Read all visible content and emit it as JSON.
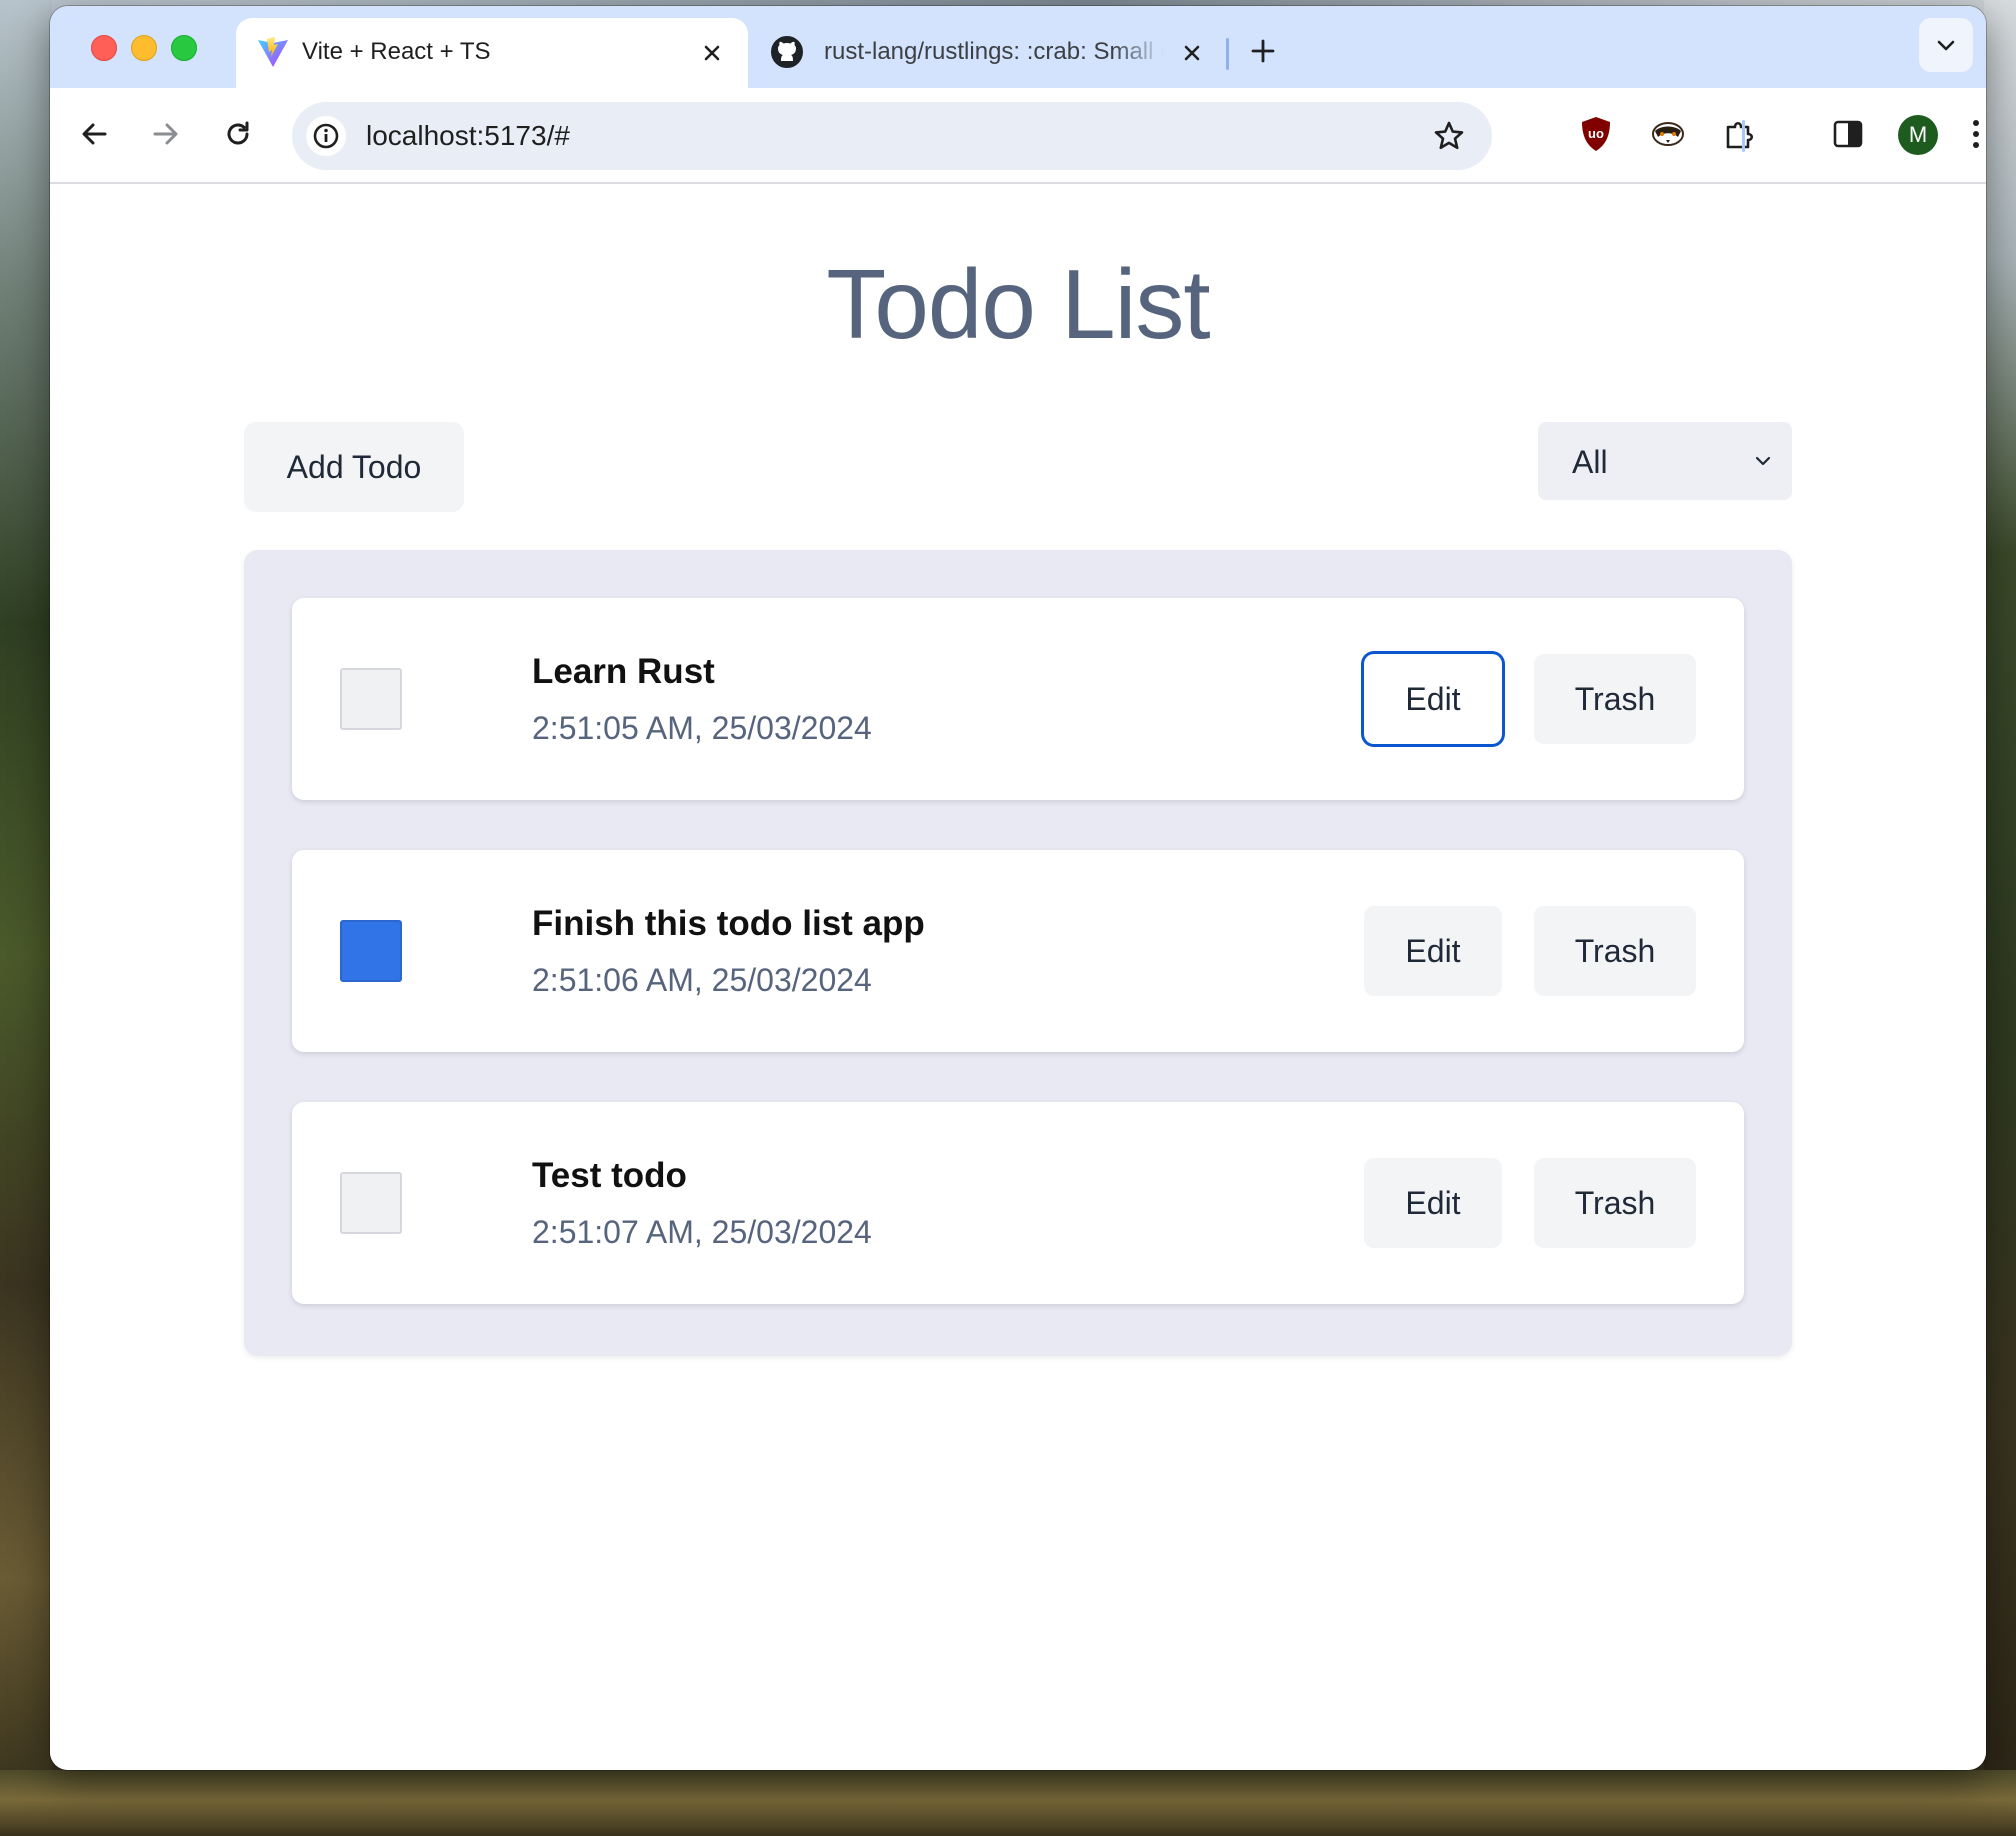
{
  "browser": {
    "tabs": [
      {
        "title": "Vite + React + TS",
        "favicon": "vite-logo-icon",
        "active": true
      },
      {
        "title": "rust-lang/rustlings: :crab: Small exercises to get you used to reading and writing Rust code!",
        "favicon": "github-logo-icon",
        "active": false
      }
    ],
    "url": "localhost:5173/#",
    "profile_initial": "M",
    "colors": {
      "tabstrip": "#d3e3fd",
      "omnibox": "#e9eef6",
      "avatar": "#1e5b1e"
    }
  },
  "app": {
    "title": "Todo List",
    "add_button_label": "Add Todo",
    "filter": {
      "selected": "All"
    },
    "todos": [
      {
        "text": "Learn Rust",
        "time": "2:51:05 AM, 25/03/2024",
        "done": false
      },
      {
        "text": "Finish this todo list app",
        "time": "2:51:06 AM, 25/03/2024",
        "done": true
      },
      {
        "text": "Test todo",
        "time": "2:51:07 AM, 25/03/2024",
        "done": false
      }
    ],
    "edit_label": "Edit",
    "trash_label": "Trash",
    "colors": {
      "title": "#56647d",
      "panel": "#e8e9f3",
      "checkbox_checked": "#3074e8",
      "focus_ring": "#0a57d0"
    }
  }
}
